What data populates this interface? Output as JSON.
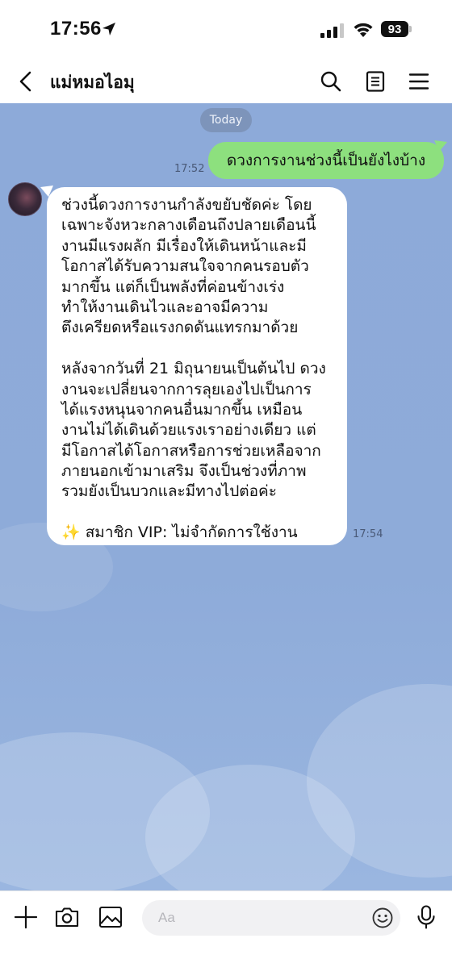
{
  "status_bar": {
    "time": "17:56",
    "battery": "93"
  },
  "header": {
    "title": "แม่หมอไอมุ"
  },
  "chat": {
    "date_label": "Today",
    "outgoing": {
      "text": "ดวงการงานช่วงนี้เป็นยังไงบ้าง",
      "time": "17:52"
    },
    "incoming": {
      "lines": [
        "ช่วงนี้ดวงการงานกำลังขยับชัดค่ะ โดย",
        "เฉพาะจังหวะกลางเดือนถึงปลายเดือนนี้",
        "งานมีแรงผลัก มีเรื่องให้เดินหน้าและมี",
        "โอกาสได้รับความสนใจจากคนรอบตัว",
        "มากขึ้น แต่ก็เป็นพลังที่ค่อนข้างเร่ง",
        "ทำให้งานเดินไวและอาจมีความ",
        "ตึงเครียดหรือแรงกดดันแทรกมาด้วย",
        "",
        "หลังจากวันที่ 21 มิถุนายนเป็นต้นไป ดวง",
        "งานจะเปลี่ยนจากการลุยเองไปเป็นการ",
        "ได้แรงหนุนจากคนอื่นมากขึ้น เหมือน",
        "งานไม่ได้เดินด้วยแรงเราอย่างเดียว แต่",
        "มีโอกาสได้โอกาสหรือการช่วยเหลือจาก",
        "ภายนอกเข้ามาเสริม จึงเป็นช่วงที่ภาพ",
        "รวมยังเป็นบวกและมีทางไปต่อค่ะ",
        "",
        "✨ สมาชิก VIP: ไม่จำกัดการใช้งาน"
      ],
      "time": "17:54"
    }
  },
  "input": {
    "placeholder": "Aa"
  },
  "colors": {
    "chat_background": "#8eabd9",
    "outgoing_bubble": "#8de07e",
    "incoming_bubble": "#ffffff"
  }
}
